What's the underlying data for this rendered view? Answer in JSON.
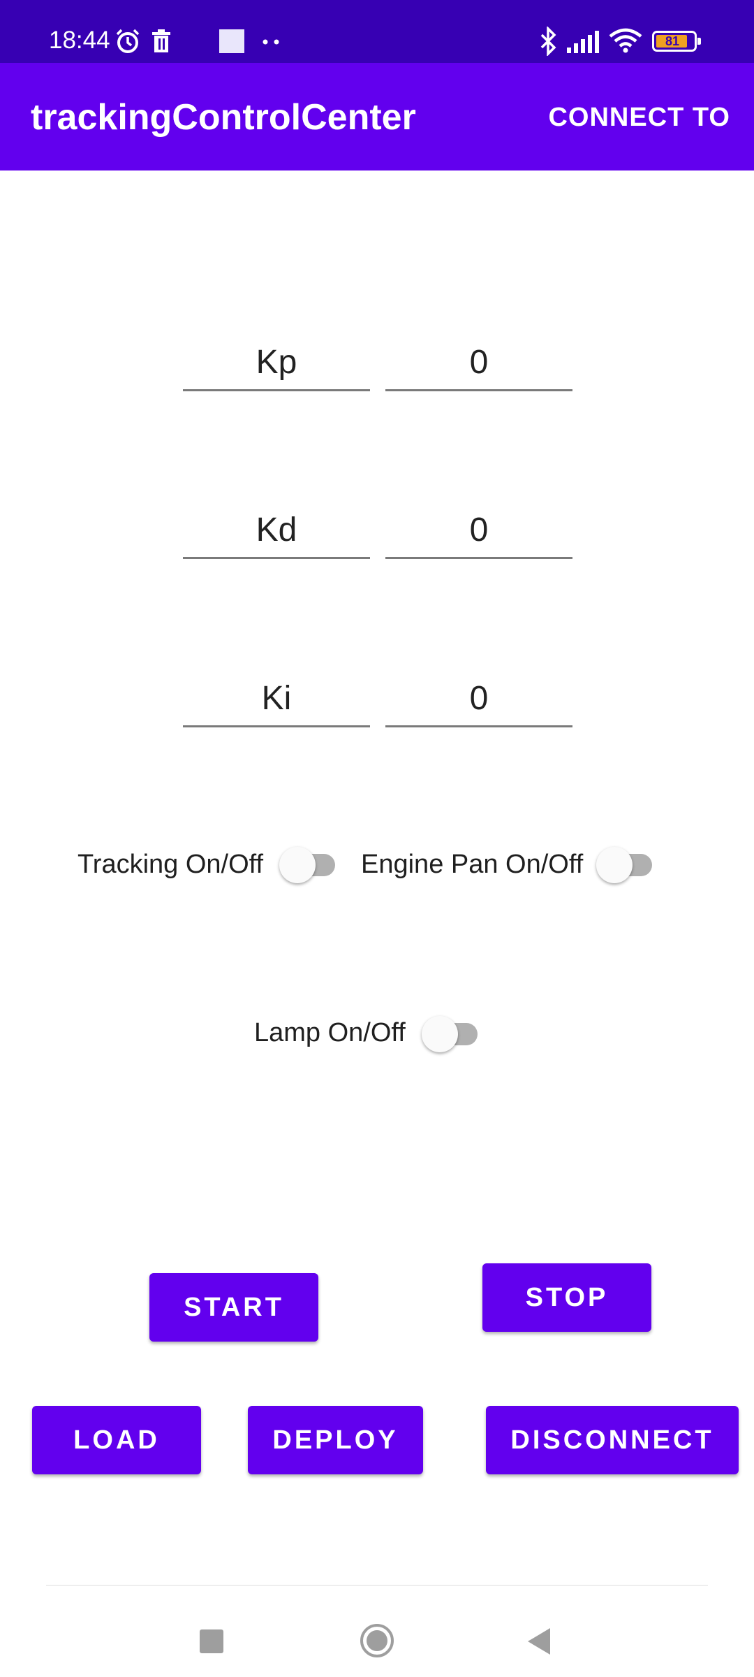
{
  "status_bar": {
    "time": "18:44",
    "battery_level": "81",
    "icons": [
      "alarm-icon",
      "trash-icon",
      "square-notification-icon",
      "more-dots-icon",
      "bluetooth-icon",
      "signal-icon",
      "wifi-icon",
      "battery-icon"
    ]
  },
  "app_bar": {
    "title": "trackingControlCenter",
    "action_label": "CONNECT TO"
  },
  "pid": {
    "kp": {
      "label": "Kp",
      "value": "0"
    },
    "kd": {
      "label": "Kd",
      "value": "0"
    },
    "ki": {
      "label": "Ki",
      "value": "0"
    }
  },
  "switches": {
    "tracking": {
      "label": "Tracking On/Off",
      "on": false
    },
    "engine_pan": {
      "label": "Engine Pan On/Off",
      "on": false
    },
    "lamp": {
      "label": "Lamp On/Off",
      "on": false
    }
  },
  "buttons": {
    "start": "START",
    "stop": "STOP",
    "load": "LOAD",
    "deploy": "DEPLOY",
    "disconnect": "DISCONNECT"
  },
  "colors": {
    "status_bar": "#3700b3",
    "primary": "#6200ee",
    "switch_track_off": "#b0b0b0"
  },
  "nav_bar": {
    "icons": [
      "recents-square-icon",
      "home-circle-icon",
      "back-triangle-icon"
    ]
  }
}
